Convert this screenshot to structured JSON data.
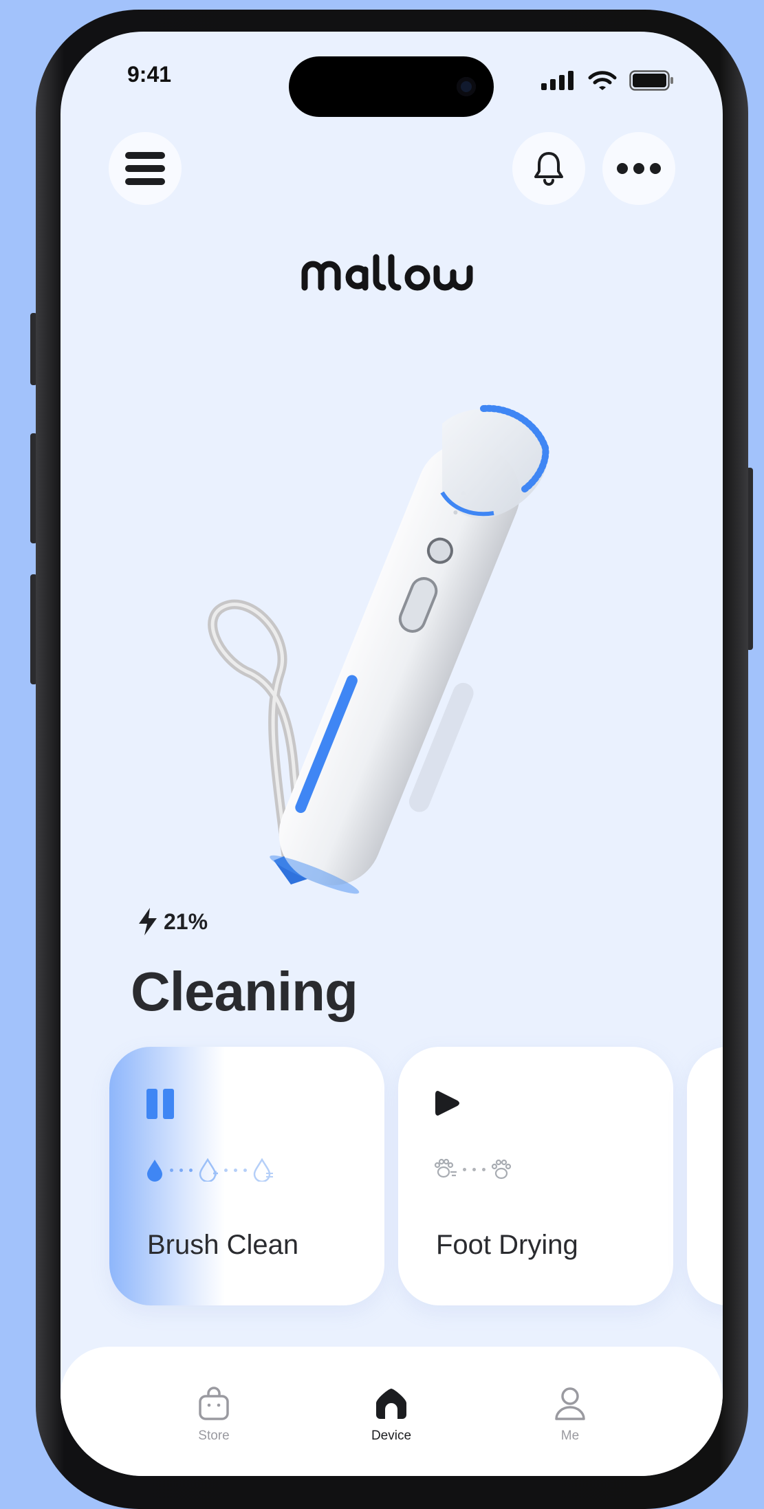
{
  "status_bar": {
    "time": "9:41"
  },
  "header": {
    "brand": "mallow",
    "menu_icon": "hamburger-icon",
    "bell_icon": "bell-icon",
    "more_icon": "ellipsis-icon"
  },
  "device": {
    "battery": "21%",
    "battery_icon": "lightning-icon",
    "status": "Cleaning"
  },
  "modes": [
    {
      "label": "Brush Clean",
      "state": "active",
      "control_icon": "pause-icon",
      "steps": [
        "droplet-icon",
        "droplet-plus-icon",
        "droplet-wave-icon"
      ]
    },
    {
      "label": "Foot Drying",
      "state": "inactive",
      "control_icon": "play-icon",
      "steps": [
        "paw-wind-icon",
        "paw-icon"
      ]
    }
  ],
  "tabs": [
    {
      "label": "Store",
      "icon": "bag-icon",
      "active": false
    },
    {
      "label": "Device",
      "icon": "home-icon",
      "active": true
    },
    {
      "label": "Me",
      "icon": "person-icon",
      "active": false
    }
  ],
  "colors": {
    "accent": "#3f86f4",
    "background": "#eaf1fe",
    "dark": "#2a2b2f",
    "inactive": "#9a9aa0",
    "frame": "#a2c2fb"
  }
}
